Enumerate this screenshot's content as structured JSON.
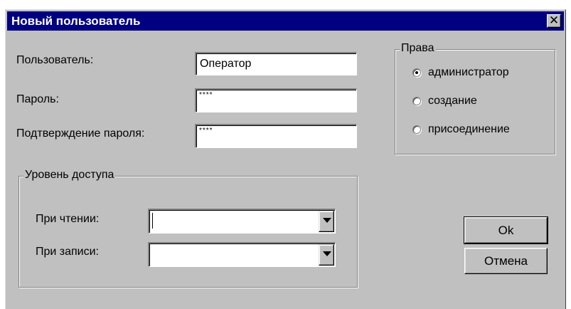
{
  "window": {
    "title": "Новый пользователь",
    "close_glyph": "✕"
  },
  "form": {
    "user_label": "Пользователь:",
    "user_value": "Оператор",
    "password_label": "Пароль:",
    "password_value": "****",
    "confirm_label": "Подтверждение пароля:",
    "confirm_value": "****"
  },
  "rights": {
    "title": "Права",
    "options": [
      {
        "label": "администратор",
        "checked": true
      },
      {
        "label": "создание",
        "checked": false
      },
      {
        "label": "присоединение",
        "checked": false
      }
    ]
  },
  "access": {
    "title": "Уровень доступа",
    "read_label": "При чтении:",
    "read_value": "",
    "write_label": "При записи:",
    "write_value": ""
  },
  "buttons": {
    "ok": "Ok",
    "cancel": "Отмена"
  },
  "colors": {
    "titlebar": "#000080",
    "face": "#c0c0c0"
  }
}
